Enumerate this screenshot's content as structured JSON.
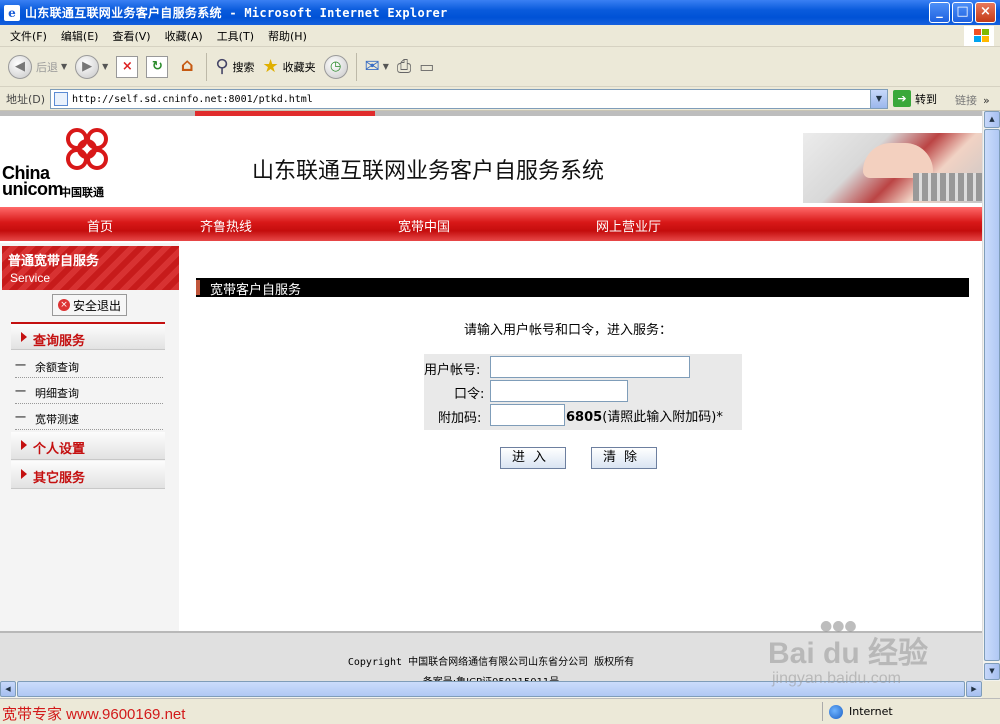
{
  "window": {
    "title": "山东联通互联网业务客户自服务系统 - Microsoft Internet Explorer",
    "buttons": [
      "_",
      "□",
      "×"
    ]
  },
  "menubar": [
    "文件(F)",
    "编辑(E)",
    "查看(V)",
    "收藏(A)",
    "工具(T)",
    "帮助(H)"
  ],
  "toolbar": {
    "back": "后退",
    "search": "搜索",
    "favorites": "收藏夹"
  },
  "addressbar": {
    "label": "地址(D)",
    "url": "http://self.sd.cninfo.net:8001/ptkd.html",
    "go": "转到",
    "links": "链接"
  },
  "header": {
    "logo_china": "China",
    "logo_unicom": "unicom",
    "logo_cn": "中国联通",
    "site_title": "山东联通互联网业务客户自服务系统"
  },
  "nav": [
    "首页",
    "齐鲁热线",
    "宽带中国",
    "网上营业厅"
  ],
  "sidebar": {
    "title": "普通宽带自服务",
    "subtitle": "Service",
    "logout": "安全退出",
    "sections": [
      {
        "label": "查询服务",
        "items": [
          "余额查询",
          "明细查询",
          "宽带测速"
        ]
      },
      {
        "label": "个人设置",
        "items": []
      },
      {
        "label": "其它服务",
        "items": []
      }
    ]
  },
  "main": {
    "panel_title": "宽带客户自服务",
    "prompt": "请输入用户帐号和口令，进入服务：",
    "labels": {
      "account": "用户帐号:",
      "password": "口令:",
      "captcha": "附加码:"
    },
    "captcha_code": "6805",
    "captcha_hint": "(请照此输入附加码)*",
    "enter": "进入",
    "clear": "清除"
  },
  "footer": {
    "copyright": "Copyright 中国联合网络通信有限公司山东省分公司 版权所有",
    "icp": "备案号:鲁ICP证050215011号"
  },
  "statusbar": {
    "watermark": "宽带专家 www.9600169.net",
    "zone": "Internet"
  },
  "watermark": {
    "brand": "Bai du 经验",
    "url": "jingyan.baidu.com"
  },
  "colors": {
    "unicom_red": "#d81818",
    "xp_blue": "#0052d6"
  }
}
